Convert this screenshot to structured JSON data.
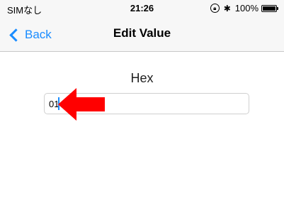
{
  "status_bar": {
    "carrier": "SIMなし",
    "time": "21:26",
    "battery_percent": "100%",
    "battery_level": 1.0,
    "icons": [
      "orientation-lock-icon",
      "bluetooth-icon",
      "battery-icon"
    ]
  },
  "nav": {
    "back_label": "Back",
    "title": "Edit Value"
  },
  "form": {
    "field_label": "Hex",
    "field_value": "01"
  },
  "annotation": {
    "arrow_color": "#ff0000",
    "arrow_icon": "arrow-left-icon"
  },
  "colors": {
    "accent": "#1a8cff"
  }
}
